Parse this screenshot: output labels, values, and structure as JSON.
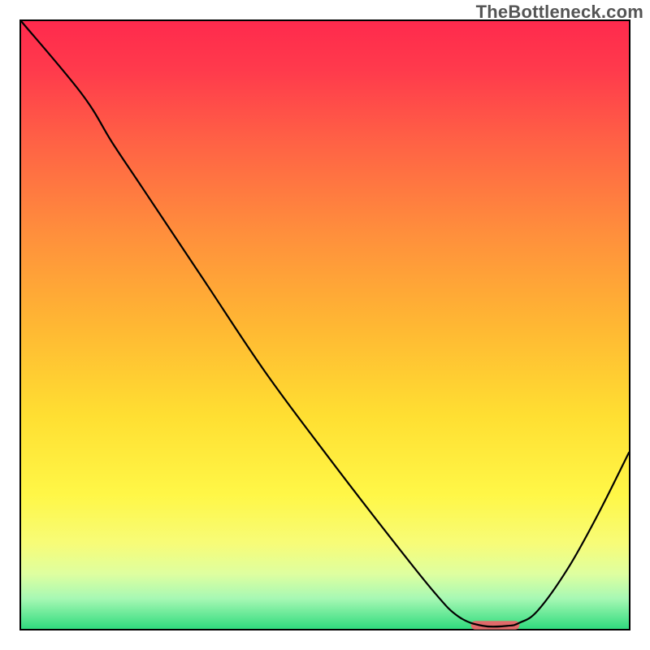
{
  "watermark": "TheBottleneck.com",
  "chart_data": {
    "type": "line",
    "title": "",
    "xlabel": "",
    "ylabel": "",
    "xlim": [
      0,
      100
    ],
    "ylim": [
      0,
      100
    ],
    "series": [
      {
        "name": "bottleneck-curve",
        "x": [
          0,
          10,
          15,
          20,
          30,
          40,
          50,
          60,
          68,
          72,
          76,
          80,
          82,
          85,
          90,
          95,
          100
        ],
        "values": [
          100,
          88,
          80,
          72.5,
          57.5,
          42.5,
          29,
          16,
          6,
          2,
          0.5,
          0.5,
          1,
          3,
          10,
          19,
          29
        ]
      }
    ],
    "marker": {
      "name": "optimal-marker",
      "x_start": 74,
      "x_end": 82,
      "y": 0.6,
      "color": "#e06a6a"
    },
    "gradient_stops": [
      {
        "offset": 0.0,
        "color": "#ff2a4d"
      },
      {
        "offset": 0.08,
        "color": "#ff3a4c"
      },
      {
        "offset": 0.2,
        "color": "#ff6245"
      },
      {
        "offset": 0.35,
        "color": "#ff8f3c"
      },
      {
        "offset": 0.5,
        "color": "#ffb733"
      },
      {
        "offset": 0.65,
        "color": "#ffdf32"
      },
      {
        "offset": 0.78,
        "color": "#fff747"
      },
      {
        "offset": 0.86,
        "color": "#f7fc78"
      },
      {
        "offset": 0.91,
        "color": "#deffa0"
      },
      {
        "offset": 0.95,
        "color": "#a7f8b4"
      },
      {
        "offset": 1.0,
        "color": "#30db7e"
      }
    ]
  }
}
